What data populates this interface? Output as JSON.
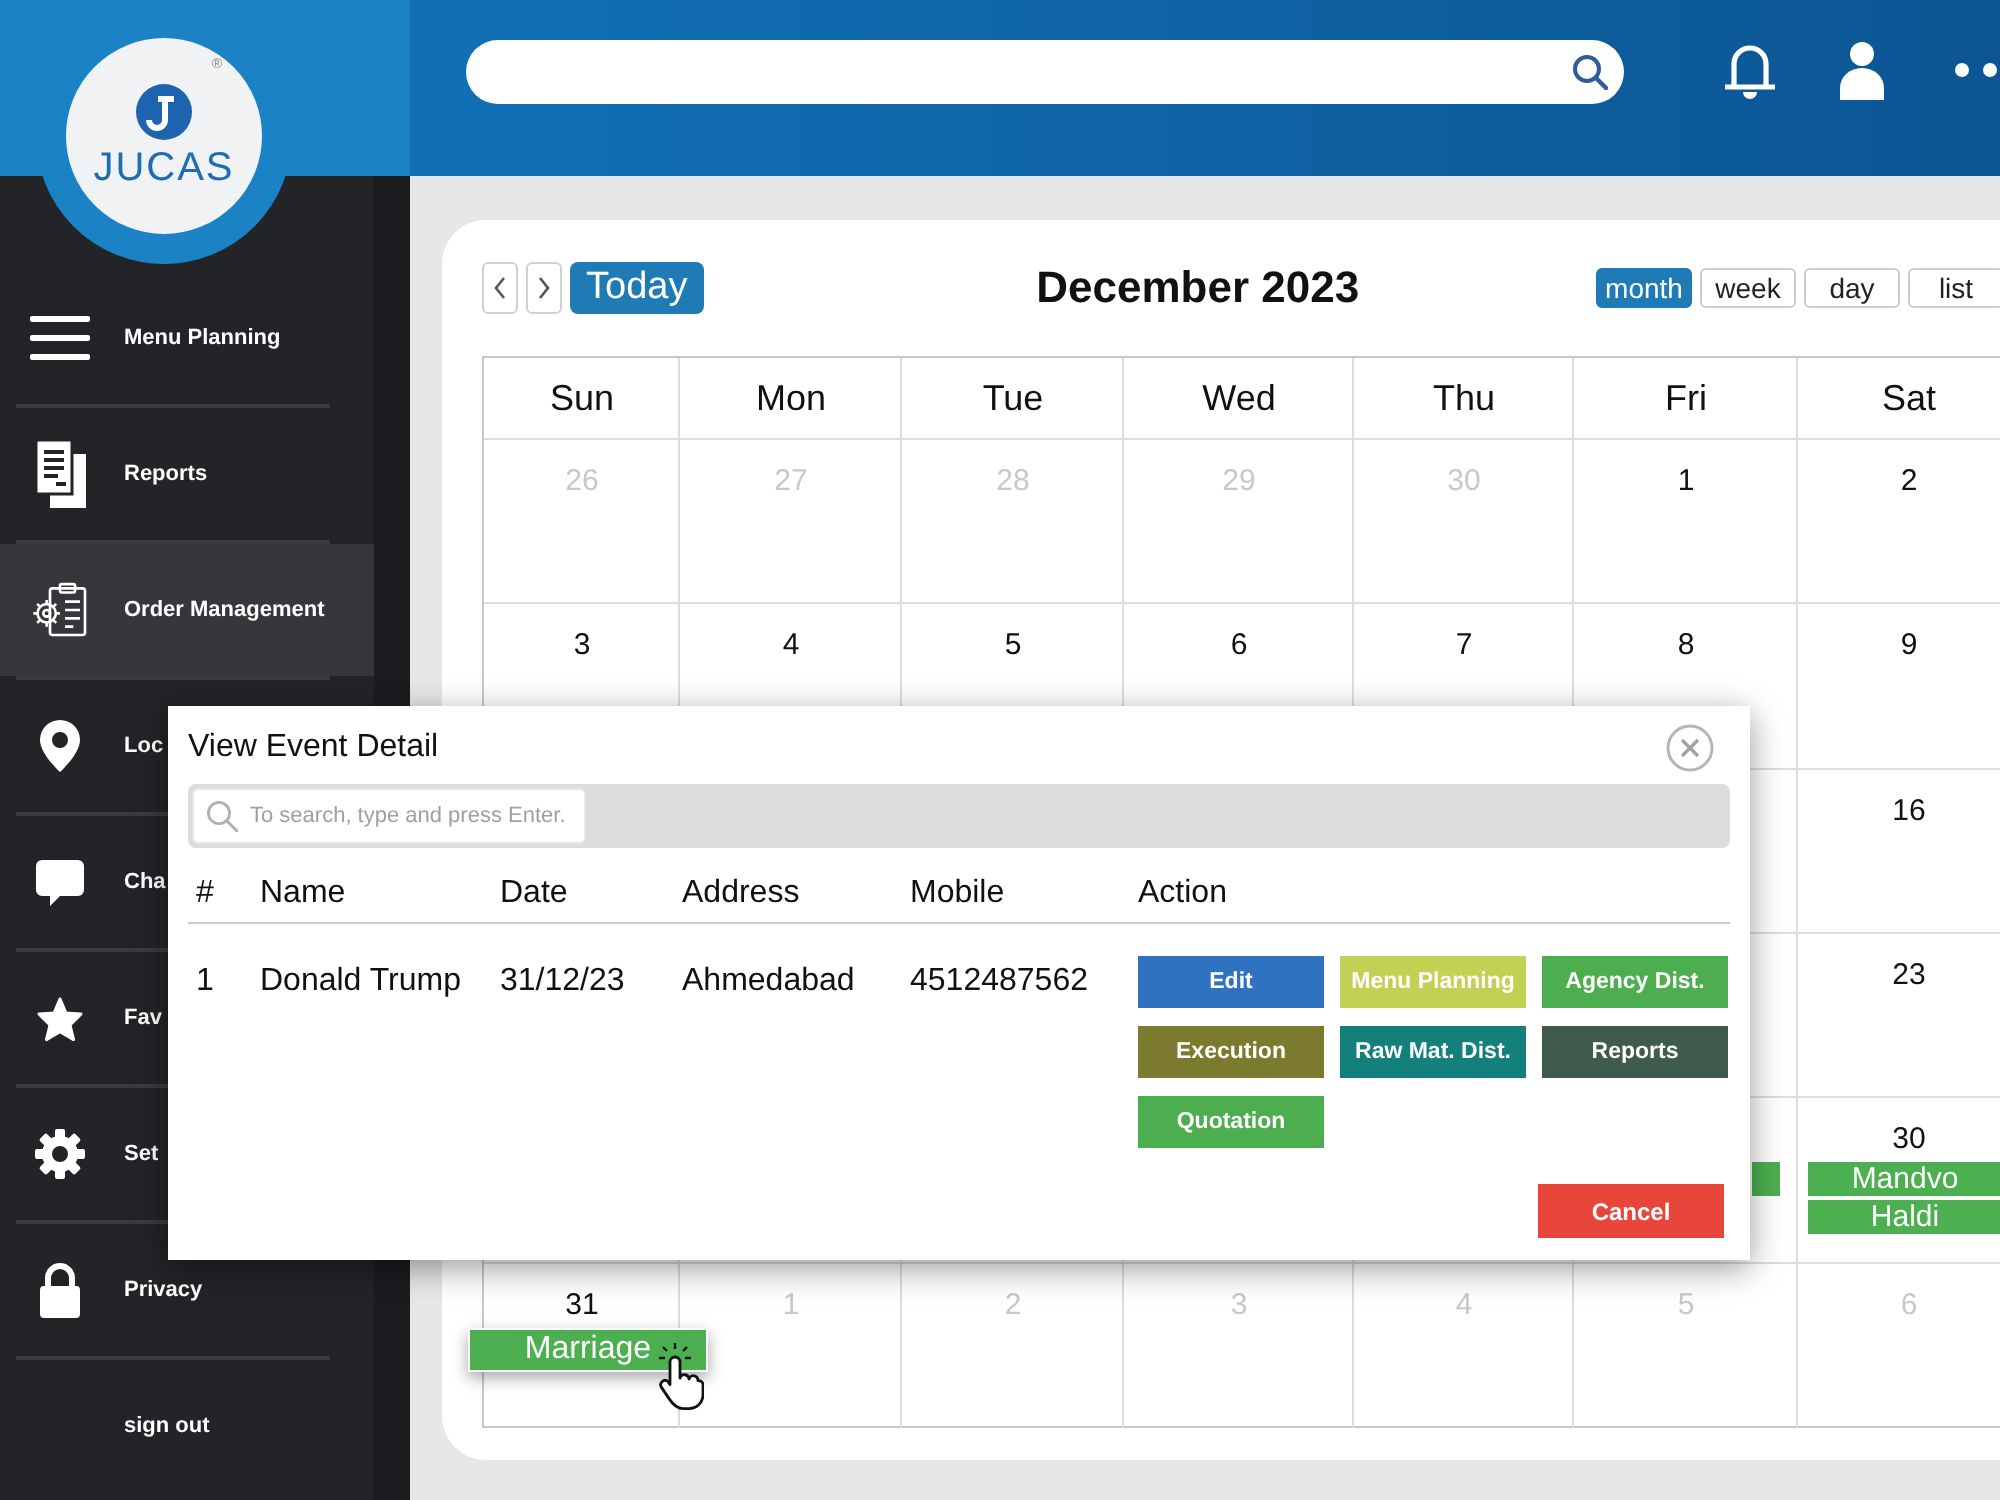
{
  "sidebar": {
    "logo": {
      "text": "JUCAS",
      "mark": "®"
    },
    "items": [
      {
        "label": "Menu Planning",
        "selected": false
      },
      {
        "label": "Reports",
        "selected": false
      },
      {
        "label": "Order Management",
        "selected": true
      },
      {
        "label": "Loc",
        "selected": false
      },
      {
        "label": "Cha",
        "selected": false
      },
      {
        "label": "Fav",
        "selected": false
      },
      {
        "label": "Set",
        "selected": false
      },
      {
        "label": "Privacy",
        "selected": false
      },
      {
        "label": "sign out",
        "selected": false
      }
    ]
  },
  "calendar": {
    "today": "Today",
    "title": "December 2023",
    "views": [
      {
        "label": "month",
        "selected": true
      },
      {
        "label": "week",
        "selected": false
      },
      {
        "label": "day",
        "selected": false
      },
      {
        "label": "list",
        "selected": false
      }
    ],
    "weekdays": [
      "Sun",
      "Mon",
      "Tue",
      "Wed",
      "Thu",
      "Fri",
      "Sat"
    ],
    "weeks": [
      {
        "days": [
          {
            "kind": "day",
            "number": "26",
            "muted": true
          },
          {
            "kind": "day",
            "number": "27",
            "muted": true
          },
          {
            "kind": "day",
            "number": "28",
            "muted": true
          },
          {
            "kind": "day",
            "number": "29",
            "muted": true
          },
          {
            "kind": "day",
            "number": "30",
            "muted": true
          },
          {
            "kind": "day",
            "number": "1",
            "muted": false
          },
          {
            "kind": "day",
            "number": "2",
            "muted": false
          }
        ]
      },
      {
        "days": [
          {
            "kind": "day",
            "number": "3",
            "muted": false
          },
          {
            "kind": "day",
            "number": "4",
            "muted": false
          },
          {
            "kind": "day",
            "number": "5",
            "muted": false
          },
          {
            "kind": "day",
            "number": "6",
            "muted": false
          },
          {
            "kind": "day",
            "number": "7",
            "muted": false
          },
          {
            "kind": "day",
            "number": "8",
            "muted": false
          },
          {
            "kind": "day",
            "number": "9",
            "muted": false
          }
        ]
      },
      {
        "days": [
          {
            "kind": "covered"
          },
          {
            "kind": "covered"
          },
          {
            "kind": "covered"
          },
          {
            "kind": "covered"
          },
          {
            "kind": "covered"
          },
          {
            "kind": "covered"
          },
          {
            "kind": "day",
            "number": "16",
            "muted": false
          }
        ]
      },
      {
        "days": [
          {
            "kind": "covered"
          },
          {
            "kind": "covered"
          },
          {
            "kind": "covered"
          },
          {
            "kind": "covered"
          },
          {
            "kind": "covered"
          },
          {
            "kind": "covered"
          },
          {
            "kind": "day",
            "number": "23",
            "muted": false
          }
        ]
      },
      {
        "days": [
          {
            "kind": "covered"
          },
          {
            "kind": "covered"
          },
          {
            "kind": "covered"
          },
          {
            "kind": "covered"
          },
          {
            "kind": "covered"
          },
          {
            "kind": "covered",
            "events": [
              {
                "hovered": false
              }
            ]
          },
          {
            "kind": "day",
            "number": "30",
            "muted": false,
            "events": [
              {
                "label": "Mandvo",
                "hovered": false
              },
              {
                "label": "Haldi",
                "hovered": false
              }
            ]
          }
        ]
      },
      {
        "days": [
          {
            "kind": "day",
            "number": "31",
            "muted": false,
            "events": [
              {
                "label": "Marriage",
                "hovered": true
              }
            ]
          },
          {
            "kind": "day",
            "number": "1",
            "muted": true
          },
          {
            "kind": "day",
            "number": "2",
            "muted": true
          },
          {
            "kind": "day",
            "number": "3",
            "muted": true
          },
          {
            "kind": "day",
            "number": "4",
            "muted": true
          },
          {
            "kind": "day",
            "number": "5",
            "muted": true
          },
          {
            "kind": "day",
            "number": "6",
            "muted": true
          }
        ]
      }
    ]
  },
  "modal": {
    "title": "View Event Detail",
    "search": {
      "placeholder": "To search, type and press Enter."
    },
    "columns": [
      "#",
      "Name",
      "Date",
      "Address",
      "Mobile",
      "Action"
    ],
    "rows": [
      {
        "cells": [
          "1",
          "Donald Trump",
          "31/12/23",
          "Ahmedabad",
          "4512487562"
        ],
        "actions": [
          {
            "label": "Edit",
            "color": "#2f72c0"
          },
          {
            "label": "Menu Planning",
            "color": "#c2d154"
          },
          {
            "label": "Agency Dist.",
            "color": "#4cae4f"
          },
          {
            "label": "Execution",
            "color": "#7b7a2e"
          },
          {
            "label": "Raw Mat. Dist.",
            "color": "#14807c"
          },
          {
            "label": "Reports",
            "color": "#3e5b4b"
          },
          {
            "label": "Quotation",
            "color": "#4cae4f"
          }
        ]
      }
    ],
    "cancel": "Cancel"
  }
}
